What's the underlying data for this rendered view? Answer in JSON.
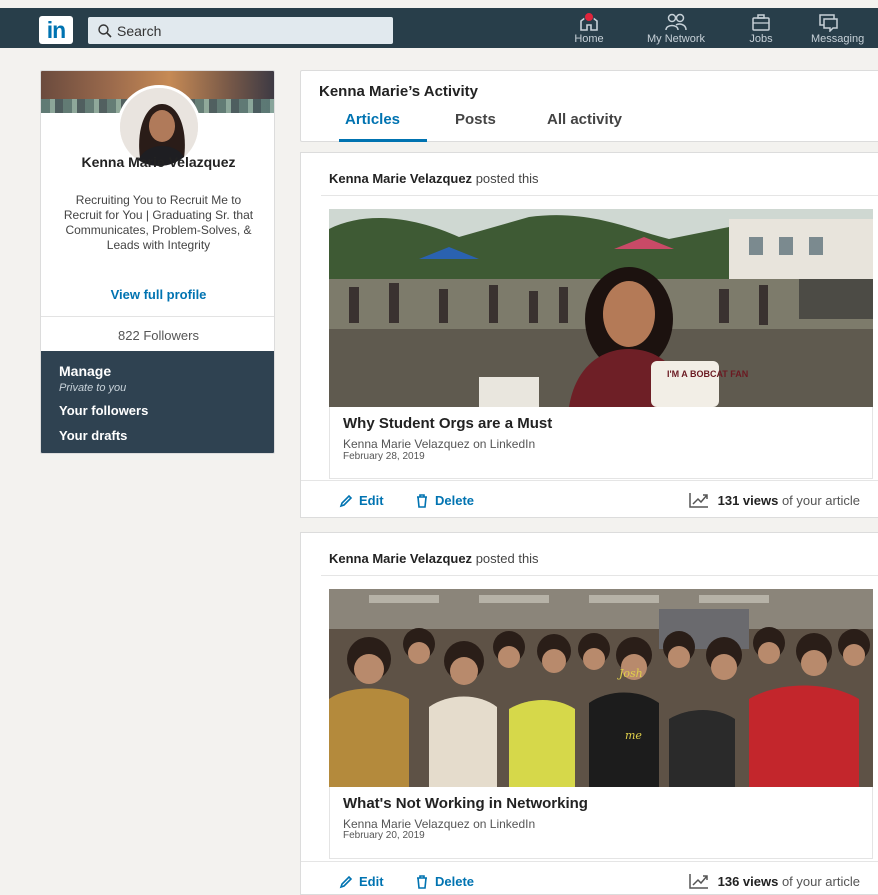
{
  "nav": {
    "logo": "in",
    "search_placeholder": "Search",
    "items": [
      {
        "label": "Home",
        "icon": "home-icon"
      },
      {
        "label": "My Network",
        "icon": "network-icon"
      },
      {
        "label": "Jobs",
        "icon": "briefcase-icon"
      },
      {
        "label": "Messaging",
        "icon": "messaging-icon"
      }
    ]
  },
  "profile": {
    "name": "Kenna Marie Velazquez",
    "headline": "Recruiting You to Recruit Me to Recruit for You | Graduating Sr. that Communicates, Problem-Solves, & Leads with Integrity",
    "view_profile": "View full profile",
    "followers": "822 Followers",
    "manage": {
      "title": "Manage",
      "privacy": "Private to you",
      "followers_link": "Your followers",
      "drafts_link": "Your drafts"
    }
  },
  "activity": {
    "title": "Kenna Marie’s Activity",
    "tabs": [
      {
        "label": "Articles",
        "active": true
      },
      {
        "label": "Posts",
        "active": false
      },
      {
        "label": "All activity",
        "active": false
      }
    ]
  },
  "posts": [
    {
      "author": "Kenna Marie Velazquez",
      "action": "posted this",
      "title": "Why Student Orgs are a Must",
      "source": "Kenna Marie Velazquez on LinkedIn",
      "date": "February 28, 2019",
      "edit": "Edit",
      "delete": "Delete",
      "views": "131 views",
      "views_suffix": "of your article",
      "sign_text": "I'M A BOBCAT FAN"
    },
    {
      "author": "Kenna Marie Velazquez",
      "action": "posted this",
      "title": "What's Not Working in Networking",
      "source": "Kenna Marie Velazquez on LinkedIn",
      "date": "February 20, 2019",
      "edit": "Edit",
      "delete": "Delete",
      "views": "136 views",
      "views_suffix": "of your article",
      "handwriting_1": "Josh",
      "handwriting_2": "me"
    }
  ],
  "colors": {
    "nav_bg": "#283e4a",
    "accent": "#0073b1",
    "manage_bg": "#2f4251",
    "page_bg": "#f3f2ef"
  }
}
